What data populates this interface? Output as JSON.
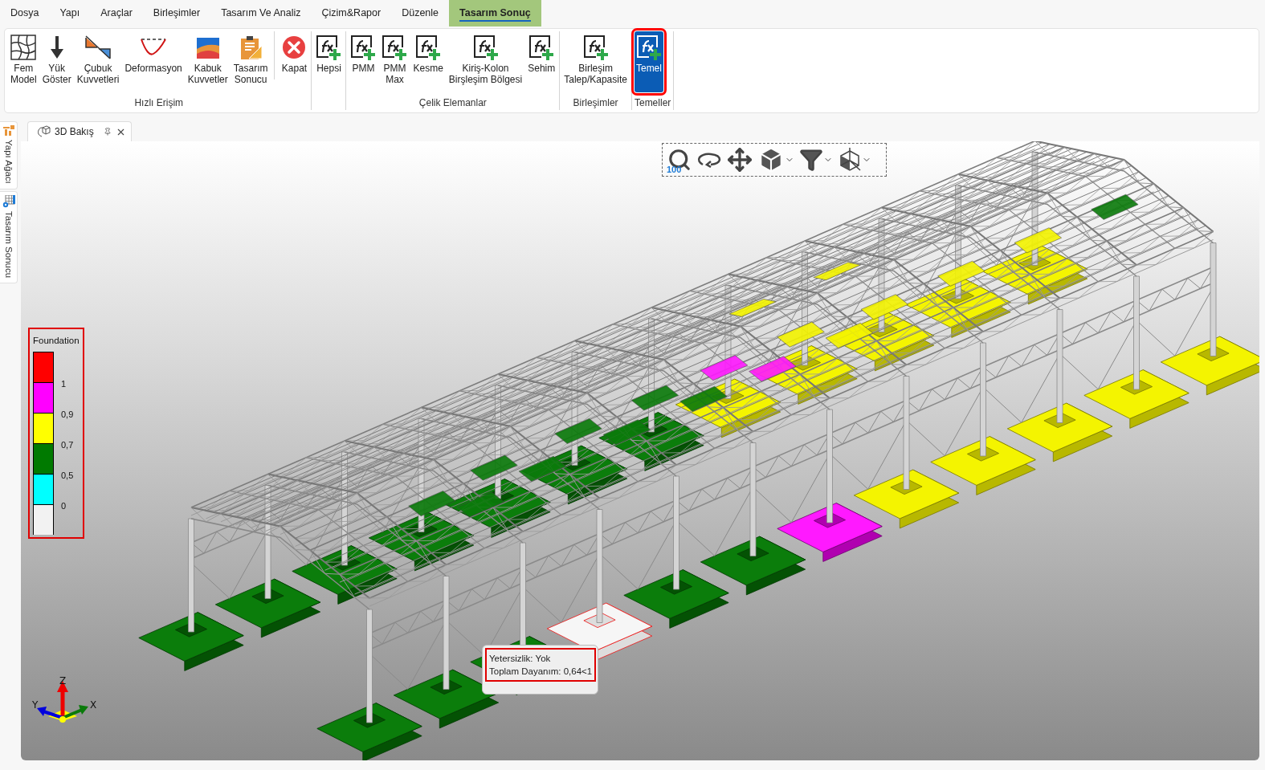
{
  "menu": [
    {
      "label": "Dosya",
      "selected": false
    },
    {
      "label": "Yapı",
      "selected": false
    },
    {
      "label": "Araçlar",
      "selected": false
    },
    {
      "label": "Birleşimler",
      "selected": false
    },
    {
      "label": "Tasarım Ve Analiz",
      "selected": false
    },
    {
      "label": "Çizim&Rapor",
      "selected": false
    },
    {
      "label": "Düzenle",
      "selected": false
    },
    {
      "label": "Tasarım Sonuç",
      "selected": true
    }
  ],
  "ribbon": [
    {
      "title": "Hızlı Erişim",
      "buttons": [
        {
          "label": "Fem\nModel",
          "kind": "mesh",
          "separated": false,
          "selected": false
        },
        {
          "label": "Yük\nGöster",
          "kind": "load",
          "separated": false,
          "selected": false
        },
        {
          "label": "Çubuk\nKuvvetleri",
          "kind": "bar-forces",
          "separated": false,
          "selected": false
        },
        {
          "label": "Deformasyon",
          "kind": "deformation",
          "separated": false,
          "selected": false
        },
        {
          "label": "Kabuk\nKuvvetler",
          "kind": "shell-forces",
          "separated": false,
          "selected": false
        },
        {
          "label": "Tasarım\nSonucu",
          "kind": "design-result",
          "separated": false,
          "selected": false
        },
        {
          "label": "Kapat",
          "kind": "close",
          "separated": true,
          "selected": false
        }
      ]
    },
    {
      "buttons": [
        {
          "label": "Hepsi",
          "kind": "formula",
          "separated": false,
          "selected": false
        }
      ]
    },
    {
      "title": "Çelik Elemanlar",
      "buttons": [
        {
          "label": "PMM",
          "kind": "formula",
          "separated": false,
          "selected": false
        },
        {
          "label": "PMM\nMax",
          "kind": "formula",
          "separated": false,
          "selected": false
        },
        {
          "label": "Kesme",
          "kind": "formula",
          "separated": false,
          "selected": false
        },
        {
          "label": "Kiriş-Kolon\nBirşleşim Bölgesi",
          "kind": "formula",
          "separated": false,
          "selected": false
        },
        {
          "label": "Sehim",
          "kind": "formula",
          "separated": false,
          "selected": false
        }
      ]
    },
    {
      "title": "Birleşimler",
      "buttons": [
        {
          "label": "Birleşim\nTalep/Kapasite",
          "kind": "formula",
          "separated": false,
          "selected": false
        }
      ]
    },
    {
      "title": "Temeller",
      "buttons": [
        {
          "label": "Temel",
          "kind": "formula",
          "separated": false,
          "selected": true
        }
      ]
    }
  ],
  "side_tabs": [
    {
      "label": "Yapı Ağacı",
      "kind": "tree"
    },
    {
      "label": "Tasarım Sonucu",
      "kind": "table"
    }
  ],
  "document_tab": {
    "title": "3D Bakış"
  },
  "view_toolbar": {
    "zoom_level": "100"
  },
  "legend": {
    "title": "Foundation",
    "items": [
      {
        "color": "#ff0000",
        "label": "1"
      },
      {
        "color": "#ff00ff",
        "label": "0,9"
      },
      {
        "color": "#ffff00",
        "label": "0,7"
      },
      {
        "color": "#007a00",
        "label": "0,5"
      },
      {
        "color": "#00ffff",
        "label": "0"
      },
      {
        "color": "#f2f2f2"
      }
    ]
  },
  "tooltip": {
    "lines": [
      "Yetersizlik: Yok",
      "Toplam Dayanım: 0,64<1"
    ]
  },
  "axes": {
    "z": "Z",
    "y": "Y",
    "x": "X"
  }
}
